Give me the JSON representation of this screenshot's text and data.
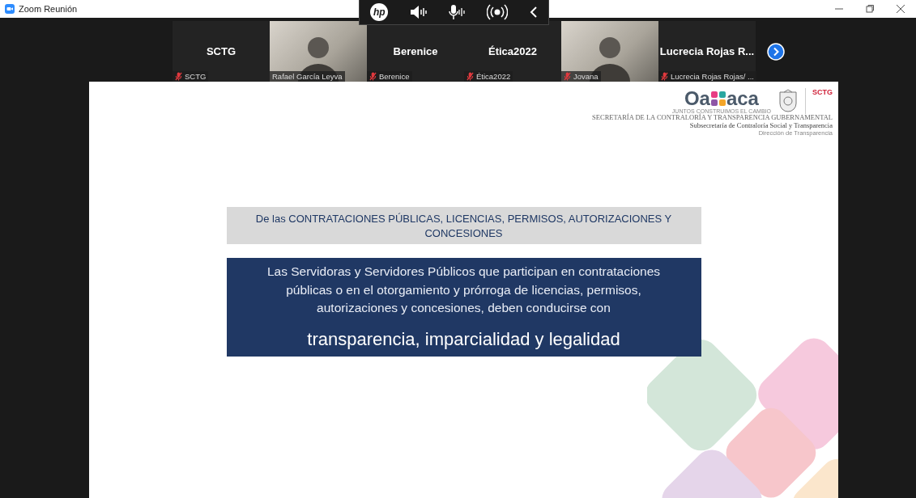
{
  "window": {
    "title": "Zoom Reunión"
  },
  "toolbar": {
    "logo": "hp"
  },
  "gallery": [
    {
      "kind": "name",
      "name": "SCTG",
      "label": "SCTG",
      "muted": true
    },
    {
      "kind": "video",
      "label": "Rafael García Leyva",
      "muted": false
    },
    {
      "kind": "name",
      "name": "Berenice",
      "label": "Berenice",
      "muted": true
    },
    {
      "kind": "name",
      "name": "Ética2022",
      "label": "Ética2022",
      "muted": true
    },
    {
      "kind": "video",
      "label": "Jovana",
      "muted": true
    },
    {
      "kind": "name",
      "name": "Lucrecia Rojas R...",
      "label": "Lucrecia Rojas Rojas/ ...",
      "muted": true
    }
  ],
  "slide": {
    "logo": {
      "left": "Oa",
      "right": "aca",
      "tagline": "JUNTOS CONSTRUIMOS EL CAMBIO",
      "badge": "SCTG"
    },
    "org_lines": [
      "SECRETARÍA DE LA CONTRALORÍA Y TRANSPARENCIA GUBERNAMENTAL",
      "Subsecretaría de Contraloría Social y Transparencia",
      "Dirección de Transparencia"
    ],
    "heading": "De las CONTRATACIONES PÚBLICAS, LICENCIAS, PERMISOS, AUTORIZACIONES Y CONCESIONES",
    "body": "Las Servidoras y Servidores Públicos que participan en contrataciones públicas o en el otorgamiento y prórroga de licencias, permisos, autorizaciones y concesiones, deben conducirse con",
    "emphasis": "transparencia, imparcialidad y legalidad"
  }
}
